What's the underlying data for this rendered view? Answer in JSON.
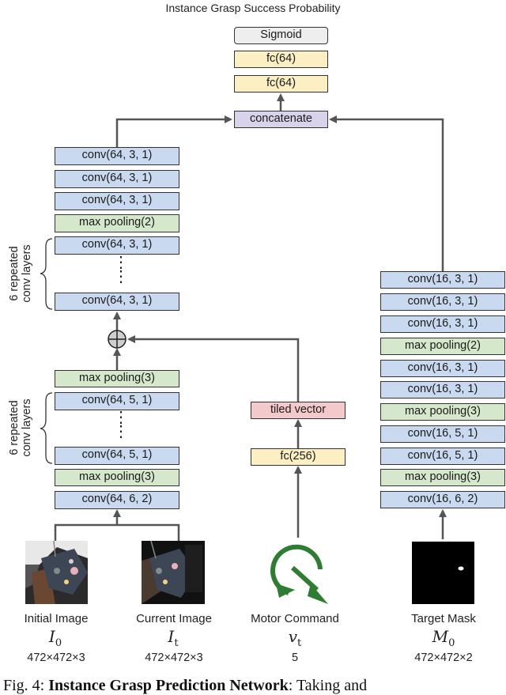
{
  "title": "Instance Grasp Success Probability",
  "head": {
    "sigmoid": "Sigmoid",
    "fc1": "fc(64)",
    "fc2": "fc(64)",
    "concatenate": "concatenate"
  },
  "left_tower": {
    "upper": [
      "conv(64, 3, 1)",
      "conv(64, 3, 1)",
      "conv(64, 3, 1)",
      "max pooling(2)",
      "conv(64, 3, 1)",
      "conv(64, 3, 1)"
    ],
    "upper_repeat_label": [
      "6 repeated",
      "conv layers"
    ],
    "lower": [
      "max pooling(3)",
      "conv(64, 5, 1)",
      "conv(64, 5, 1)",
      "max pooling(3)",
      "conv(64, 6, 2)"
    ],
    "lower_repeat_label": [
      "6 repeated",
      "conv layers"
    ],
    "ellipsis": "⋮"
  },
  "middle_branch": {
    "tiled": "tiled vector",
    "fc": "fc(256)"
  },
  "right_tower": {
    "layers": [
      "conv(16, 3, 1)",
      "conv(16, 3, 1)",
      "conv(16, 3, 1)",
      "max pooling(2)",
      "conv(16, 3, 1)",
      "conv(16, 3, 1)",
      "max pooling(3)",
      "conv(16, 5, 1)",
      "conv(16, 5, 1)",
      "max pooling(3)",
      "conv(16, 6, 2)"
    ]
  },
  "inputs": [
    {
      "label": "Initial Image",
      "symbol": "I",
      "sub": "0",
      "dims": "472×472×3"
    },
    {
      "label": "Current Image",
      "symbol": "I",
      "sub": "t",
      "dims": "472×472×3"
    },
    {
      "label": "Motor Command",
      "symbol": "v",
      "sub": "t",
      "dims": "5"
    },
    {
      "label": "Target Mask",
      "symbol": "M",
      "sub": "0",
      "dims": "472×472×2"
    }
  ],
  "caption": {
    "prefix": "Fig. 4: ",
    "bold": "Instance Grasp Prediction Network",
    "rest": ": Taking and"
  },
  "colors": {
    "conv": "#c9d9ef",
    "pool": "#d6e8cc",
    "fc": "#fcefc4",
    "concat": "#d9d2eb",
    "tiled": "#f4c9cc",
    "motor_arrow": "#2e7d32"
  }
}
